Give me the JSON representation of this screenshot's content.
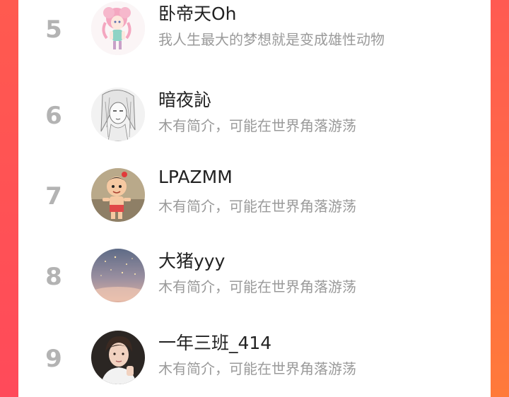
{
  "leaderboard": {
    "rows": [
      {
        "rank": "5",
        "name": "卧帝天Oh",
        "bio": "我人生最大的梦想就是变成雄性动物",
        "avatar_icon": "anime-girl-pink-hair-avatar"
      },
      {
        "rank": "6",
        "name": "暗夜訫",
        "bio": "木有简介，可能在世界角落游荡",
        "avatar_icon": "sketch-girl-avatar"
      },
      {
        "rank": "7",
        "name": "LPAZMM",
        "bio": "木有简介，可能在世界角落游荡",
        "avatar_icon": "cartoon-boy-avatar"
      },
      {
        "rank": "8",
        "name": "大猪yyy",
        "bio": "木有简介，可能在世界角落游荡",
        "avatar_icon": "sunset-sky-avatar"
      },
      {
        "rank": "9",
        "name": "一年三班_414",
        "bio": "木有简介，可能在世界角落游荡",
        "avatar_icon": "young-man-portrait-avatar"
      }
    ]
  },
  "colors": {
    "accent_left": "#ff4a5a",
    "accent_right": "#ff7a3a",
    "rank_color": "#b3b3b3",
    "name_color": "#222222",
    "bio_color": "#9a9a9a"
  }
}
